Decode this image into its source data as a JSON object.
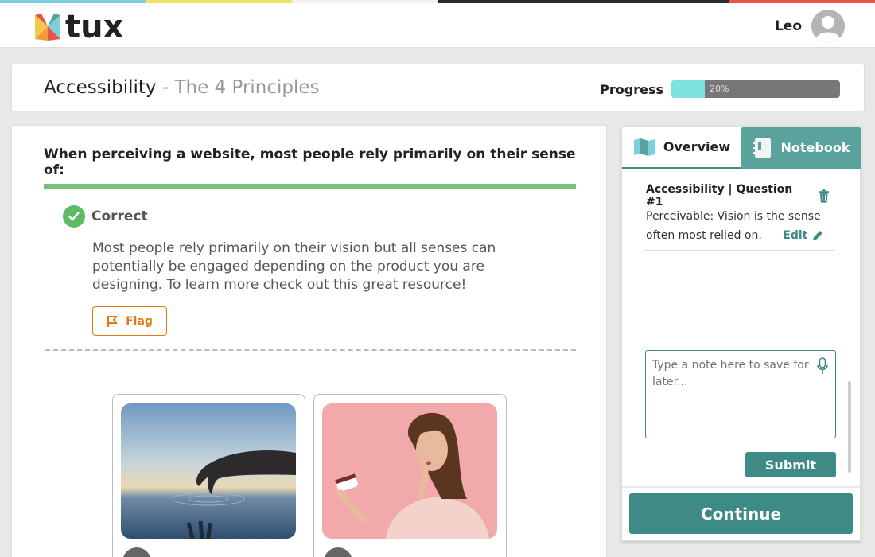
{
  "stripe_colors": [
    "#7ecfdc",
    "#f2e463",
    "#f2f2f2",
    "#2b2b2b",
    "#2b2b2b",
    "#e8534a"
  ],
  "brand": {
    "name": "tux",
    "logo_icon": "tux-logo-icon"
  },
  "user": {
    "name": "Leo",
    "avatar_icon": "user-avatar-icon"
  },
  "lesson": {
    "title": "Accessibility",
    "subtitle": " - The 4 Principles"
  },
  "progress": {
    "label": "Progress",
    "value_text": "20%",
    "fraction": 0.2,
    "fill_color": "#7de2dc"
  },
  "question": {
    "prompt": "When perceiving a website, most people rely primarily on their sense of:",
    "result_label": "Correct",
    "explanation_before": "Most people rely primarily on their vision but all senses can potentially be engaged depending on the product you are designing. To learn more check out this ",
    "explanation_link": "great resource",
    "explanation_after": "!",
    "flag_label": "Flag"
  },
  "answers": [
    {
      "name": "answer-touch-image"
    },
    {
      "name": "answer-taste-image"
    }
  ],
  "panel": {
    "tabs": [
      {
        "label": "Overview",
        "icon": "map-icon"
      },
      {
        "label": "Notebook",
        "icon": "notebook-icon"
      }
    ],
    "note": {
      "heading": "Accessibility | Question #1",
      "text": "Perceivable: Vision is the sense often most relied on.",
      "edit_label": "Edit"
    },
    "input_placeholder": "Type a note here to save for later...",
    "submit_label": "Submit",
    "continue_label": "Continue"
  },
  "colors": {
    "accent": "#3d8a86",
    "correct": "#5dbb63",
    "flag": "#e07b12"
  }
}
